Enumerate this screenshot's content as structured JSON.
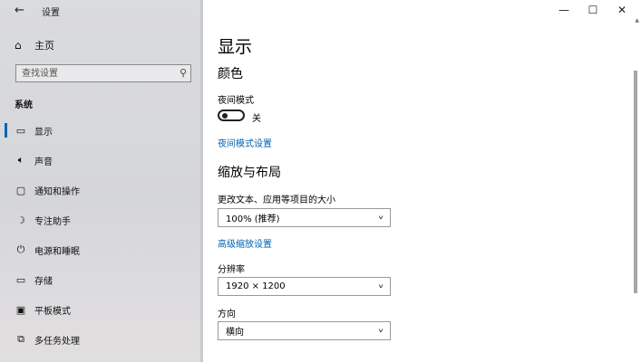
{
  "window": {
    "title": "设置",
    "controls": {
      "minimize": "—",
      "maximize": "☐",
      "close": "✕"
    }
  },
  "sidebar": {
    "home_label": "主页",
    "search_placeholder": "查找设置",
    "section": "系统",
    "items": [
      {
        "label": "显示",
        "icon": "monitor-icon",
        "glyph": "▭",
        "active": true
      },
      {
        "label": "声音",
        "icon": "speaker-icon",
        "glyph": "🔈︎",
        "active": false
      },
      {
        "label": "通知和操作",
        "icon": "notification-icon",
        "glyph": "▢",
        "active": false
      },
      {
        "label": "专注助手",
        "icon": "moon-icon",
        "glyph": "☽",
        "active": false
      },
      {
        "label": "电源和睡眠",
        "icon": "power-icon",
        "glyph": "⏻",
        "active": false
      },
      {
        "label": "存储",
        "icon": "storage-icon",
        "glyph": "▭",
        "active": false
      },
      {
        "label": "平板模式",
        "icon": "tablet-icon",
        "glyph": "▣",
        "active": false
      },
      {
        "label": "多任务处理",
        "icon": "multitask-icon",
        "glyph": "⧉",
        "active": false
      }
    ]
  },
  "main": {
    "title": "显示",
    "color_section": {
      "heading": "颜色",
      "night_light_label": "夜间模式",
      "night_light_state": "关",
      "night_light_on": false,
      "night_light_link": "夜间模式设置"
    },
    "scale_section": {
      "heading": "缩放与布局",
      "scale_label": "更改文本、应用等项目的大小",
      "scale_value": "100% (推荐)",
      "advanced_link": "高级缩放设置",
      "resolution_label": "分辨率",
      "resolution_value": "1920 × 1200",
      "orientation_label": "方向",
      "orientation_value": "横向"
    }
  },
  "colors": {
    "accent": "#0063b1",
    "sidebar_bg": "#d8d9dd"
  }
}
